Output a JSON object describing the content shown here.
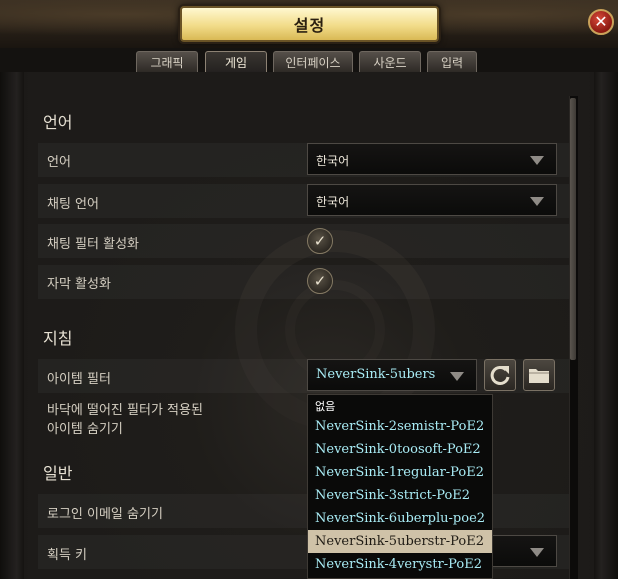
{
  "window": {
    "title": "설정",
    "close_icon": "close-icon"
  },
  "tabs": [
    {
      "label": "그래픽",
      "active": false
    },
    {
      "label": "게임",
      "active": true
    },
    {
      "label": "인터페이스",
      "active": false
    },
    {
      "label": "사운드",
      "active": false
    },
    {
      "label": "입력",
      "active": false
    }
  ],
  "sections": {
    "language": {
      "title": "언어",
      "language_label": "언어",
      "language_value": "한국어",
      "chat_language_label": "채팅 언어",
      "chat_language_value": "한국어",
      "chat_filter_label": "채팅 필터 활성화",
      "chat_filter_checked": true,
      "subtitles_label": "자막 활성화",
      "subtitles_checked": true
    },
    "guide": {
      "title": "지침",
      "item_filter_label": "아이템 필터",
      "item_filter_value": "NeverSink-5ubers",
      "hide_filtered_label_line1": "바닥에 떨어진 필터가 적용된",
      "hide_filtered_label_line2": "아이템 숨기기"
    },
    "general": {
      "title": "일반",
      "hide_email_label": "로그인 이메일 숨기기",
      "loot_key_label": "획득 키"
    }
  },
  "filter_dropdown": {
    "options": [
      "없음",
      "NeverSink-2semistr-PoE2",
      "NeverSink-0toosoft-PoE2",
      "NeverSink-1regular-PoE2",
      "NeverSink-3strict-PoE2",
      "NeverSink-6uberplu-poe2",
      "NeverSink-5uberstr-PoE2",
      "NeverSink-4verystr-PoE2"
    ],
    "highlighted_index": 6
  },
  "colors": {
    "accent_gold": "#f2dc8a",
    "filter_text": "#a9ecf5",
    "highlight_bg": "#cfc2a8"
  }
}
